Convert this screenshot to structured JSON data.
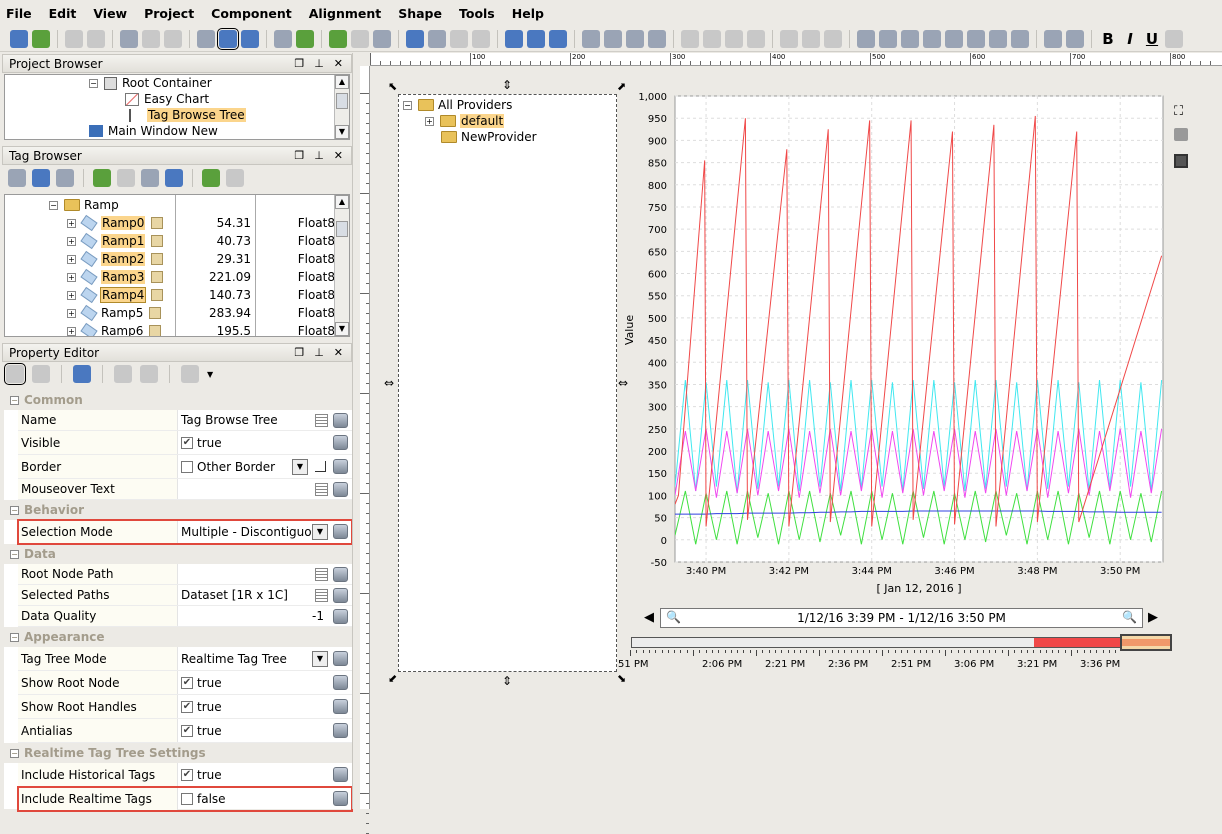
{
  "menu": [
    "File",
    "Edit",
    "View",
    "Project",
    "Component",
    "Alignment",
    "Shape",
    "Tools",
    "Help"
  ],
  "toolbar": {
    "bold": "B",
    "italic": "I",
    "underline": "U"
  },
  "project_browser": {
    "title": "Project Browser",
    "items": [
      "Root Container",
      "Easy Chart",
      "Tag Browse Tree",
      "Main Window New"
    ]
  },
  "tag_browser": {
    "title": "Tag Browser",
    "folder": "Ramp",
    "tags": [
      {
        "name": "Ramp0",
        "value": "54.31",
        "type": "Float8",
        "selected": true
      },
      {
        "name": "Ramp1",
        "value": "40.73",
        "type": "Float8",
        "selected": true
      },
      {
        "name": "Ramp2",
        "value": "29.31",
        "type": "Float8",
        "selected": true
      },
      {
        "name": "Ramp3",
        "value": "221.09",
        "type": "Float8",
        "selected": true
      },
      {
        "name": "Ramp4",
        "value": "140.73",
        "type": "Float8",
        "selected": true
      },
      {
        "name": "Ramp5",
        "value": "283.94",
        "type": "Float8",
        "selected": false
      },
      {
        "name": "Ramp6",
        "value": "195.5",
        "type": "Float8",
        "selected": false
      }
    ]
  },
  "property_editor": {
    "title": "Property Editor",
    "sections": [
      {
        "name": "Common",
        "rows": [
          {
            "name": "Name",
            "value": "Tag Browse Tree",
            "kind": "text"
          },
          {
            "name": "Visible",
            "value": "true",
            "kind": "check",
            "checked": true
          },
          {
            "name": "Border",
            "value": "Other Border",
            "kind": "checkdd",
            "checked": false
          },
          {
            "name": "Mouseover Text",
            "value": "",
            "kind": "text"
          }
        ]
      },
      {
        "name": "Behavior",
        "rows": [
          {
            "name": "Selection Mode",
            "value": "Multiple - Discontiguo...",
            "kind": "dropdown",
            "highlight": true
          }
        ]
      },
      {
        "name": "Data",
        "rows": [
          {
            "name": "Root Node Path",
            "value": "",
            "kind": "text"
          },
          {
            "name": "Selected Paths",
            "value": "Dataset [1R x 1C]",
            "kind": "dataset"
          },
          {
            "name": "Data Quality",
            "value": "-1",
            "kind": "number"
          }
        ]
      },
      {
        "name": "Appearance",
        "rows": [
          {
            "name": "Tag Tree Mode",
            "value": "Realtime Tag Tree",
            "kind": "dropdown"
          },
          {
            "name": "Show Root Node",
            "value": "true",
            "kind": "check",
            "checked": true
          },
          {
            "name": "Show Root Handles",
            "value": "true",
            "kind": "check",
            "checked": true
          },
          {
            "name": "Antialias",
            "value": "true",
            "kind": "check",
            "checked": true
          }
        ]
      },
      {
        "name": "Realtime Tag Tree Settings",
        "rows": [
          {
            "name": "Include Historical Tags",
            "value": "true",
            "kind": "check",
            "checked": true
          },
          {
            "name": "Include Realtime Tags",
            "value": "false",
            "kind": "check",
            "checked": false,
            "highlight": true
          }
        ]
      }
    ]
  },
  "ruler": [
    "100",
    "200",
    "300",
    "400",
    "500",
    "600",
    "700",
    "800"
  ],
  "tag_tree": {
    "root": "All Providers",
    "children": [
      "default",
      "NewProvider"
    ]
  },
  "chart_data": {
    "type": "line",
    "ylabel": "Value",
    "xlabel": "[ Jan 12, 2016 ]",
    "ylim": [
      -50,
      1000
    ],
    "yticks": [
      "1,000",
      "950",
      "900",
      "850",
      "800",
      "750",
      "700",
      "650",
      "600",
      "550",
      "500",
      "450",
      "400",
      "350",
      "300",
      "250",
      "200",
      "150",
      "100",
      "50",
      "0",
      "-50"
    ],
    "xlim": [
      "15:39:15",
      "15:51:02"
    ],
    "xticks": [
      {
        "t": "15:40:00",
        "label": "3:40 PM"
      },
      {
        "t": "15:42:00",
        "label": "3:42 PM"
      },
      {
        "t": "15:44:00",
        "label": "3:44 PM"
      },
      {
        "t": "15:46:00",
        "label": "3:46 PM"
      },
      {
        "t": "15:48:00",
        "label": "3:48 PM"
      },
      {
        "t": "15:50:00",
        "label": "3:50 PM"
      }
    ],
    "grid": true,
    "red": {
      "color": "#f04848",
      "points": [
        [
          "15:39:15",
          80
        ],
        [
          "15:39:20",
          100
        ],
        [
          "15:39:58",
          855
        ],
        [
          "15:40:00",
          30
        ],
        [
          "15:40:57",
          950
        ],
        [
          "15:41:00",
          45
        ],
        [
          "15:41:57",
          880
        ],
        [
          "15:42:00",
          30
        ],
        [
          "15:42:57",
          925
        ],
        [
          "15:43:00",
          40
        ],
        [
          "15:43:57",
          945
        ],
        [
          "15:44:00",
          30
        ],
        [
          "15:44:57",
          945
        ],
        [
          "15:45:00",
          45
        ],
        [
          "15:45:57",
          920
        ],
        [
          "15:46:00",
          35
        ],
        [
          "15:46:57",
          935
        ],
        [
          "15:47:00",
          30
        ],
        [
          "15:47:57",
          955
        ],
        [
          "15:48:00",
          40
        ],
        [
          "15:48:57",
          920
        ],
        [
          "15:49:00",
          40
        ],
        [
          "15:51:00",
          640
        ]
      ]
    },
    "x": [
      "15:39:15",
      "15:39:30",
      "15:39:45",
      "15:40:00",
      "15:40:15",
      "15:40:30",
      "15:40:45",
      "15:41:00",
      "15:41:15",
      "15:41:30",
      "15:41:45",
      "15:42:00",
      "15:42:15",
      "15:42:30",
      "15:42:45",
      "15:43:00",
      "15:43:15",
      "15:43:30",
      "15:43:45",
      "15:44:00",
      "15:44:15",
      "15:44:30",
      "15:44:45",
      "15:45:00",
      "15:45:15",
      "15:45:30",
      "15:45:45",
      "15:46:00",
      "15:46:15",
      "15:46:30",
      "15:46:45",
      "15:47:00",
      "15:47:15",
      "15:47:30",
      "15:47:45",
      "15:48:00",
      "15:48:15",
      "15:48:30",
      "15:48:45",
      "15:49:00",
      "15:49:15",
      "15:49:30",
      "15:49:45",
      "15:50:00",
      "15:50:15",
      "15:50:30",
      "15:50:45",
      "15:51:00"
    ],
    "series": [
      {
        "color": "#40e8f0",
        "values": [
          120,
          360,
          110,
          355,
          120,
          360,
          105,
          360,
          115,
          355,
          120,
          360,
          110,
          360,
          120,
          355,
          110,
          360,
          115,
          360,
          120,
          355,
          110,
          360,
          115,
          360,
          120,
          355,
          110,
          360,
          115,
          360,
          120,
          355,
          110,
          360,
          115,
          360,
          120,
          355,
          110,
          360,
          115,
          360,
          120,
          355,
          110,
          360
        ]
      },
      {
        "color": "#f048f0",
        "values": [
          100,
          245,
          110,
          250,
          95,
          245,
          105,
          250,
          100,
          245,
          110,
          250,
          95,
          245,
          105,
          250,
          100,
          245,
          110,
          250,
          95,
          245,
          105,
          250,
          100,
          245,
          110,
          250,
          95,
          245,
          105,
          250,
          100,
          245,
          110,
          250,
          95,
          245,
          105,
          250,
          100,
          245,
          110,
          250,
          95,
          245,
          105,
          250
        ]
      },
      {
        "color": "#40e040",
        "values": [
          10,
          110,
          -10,
          105,
          0,
          110,
          -10,
          110,
          5,
          105,
          -10,
          110,
          0,
          110,
          -5,
          105,
          10,
          110,
          -10,
          110,
          0,
          105,
          -10,
          110,
          5,
          110,
          -10,
          105,
          0,
          110,
          -5,
          110,
          10,
          105,
          -10,
          110,
          0,
          110,
          -10,
          105,
          5,
          110,
          -10,
          110,
          0,
          105,
          -5,
          110
        ]
      },
      {
        "color": "#3040e0",
        "values": [
          58,
          58,
          58,
          58,
          59,
          59,
          59,
          60,
          60,
          60,
          60,
          60,
          61,
          61,
          62,
          62,
          63,
          63,
          64,
          64,
          64,
          64,
          64,
          65,
          65,
          65,
          65,
          65,
          65,
          65,
          65,
          65,
          65,
          65,
          65,
          65,
          64,
          64,
          64,
          64,
          63,
          63,
          63,
          62,
          62,
          62,
          62,
          62
        ]
      }
    ],
    "range_label": "1/12/16 3:39 PM - 1/12/16 3:50 PM",
    "overview_ticks": [
      "51 PM",
      "2:06 PM",
      "2:21 PM",
      "2:36 PM",
      "2:51 PM",
      "3:06 PM",
      "3:21 PM",
      "3:36 PM"
    ]
  }
}
